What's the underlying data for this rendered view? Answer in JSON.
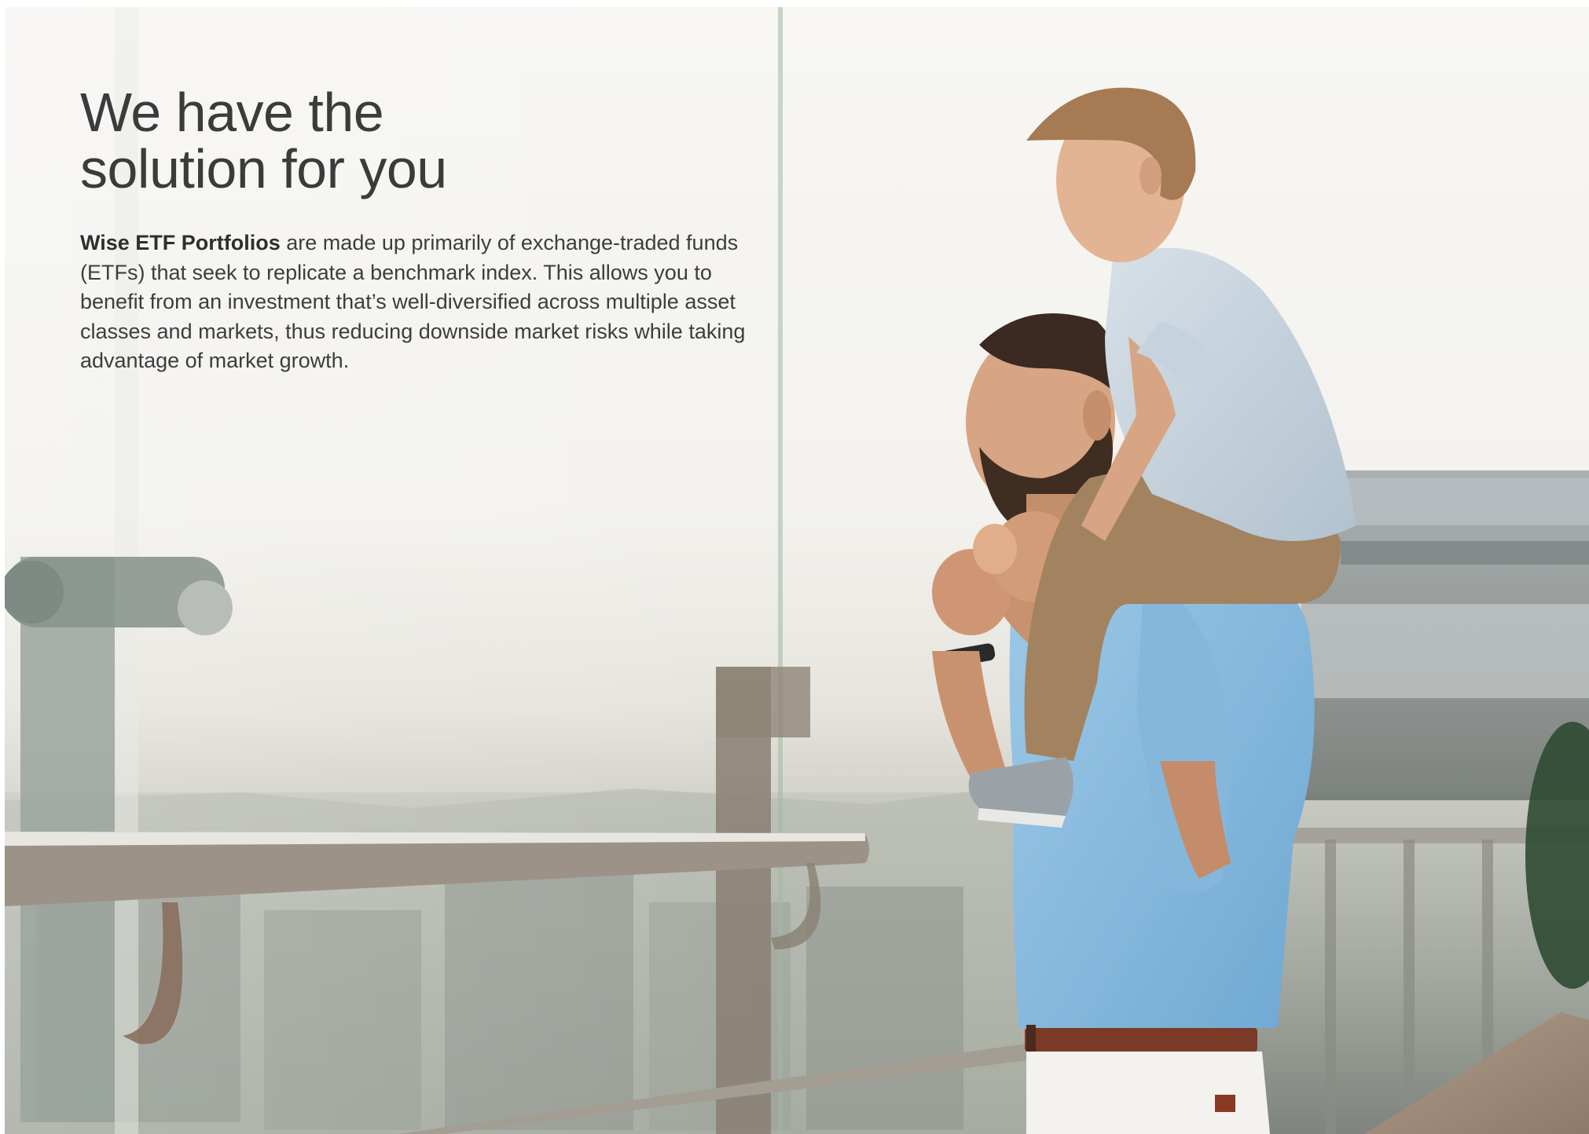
{
  "hero": {
    "title_line1": "We have the",
    "title_line2": "solution for you",
    "brand_term": "Wise ETF Portfolios",
    "body_text": " are made up primarily of exchange-traded funds (ETFs) that seek to replicate a benchmark index. This allows you to benefit from an investment that’s well-diversified across multiple asset classes and markets, thus reducing downside market risks while taking advantage of market growth."
  },
  "photo": {
    "subject": "father-carrying-son-on-shoulders-icon",
    "shirt_color": "#8fc0e2",
    "child_shirt_color": "#c6d3de",
    "sky_color": "#f3f2ee"
  }
}
